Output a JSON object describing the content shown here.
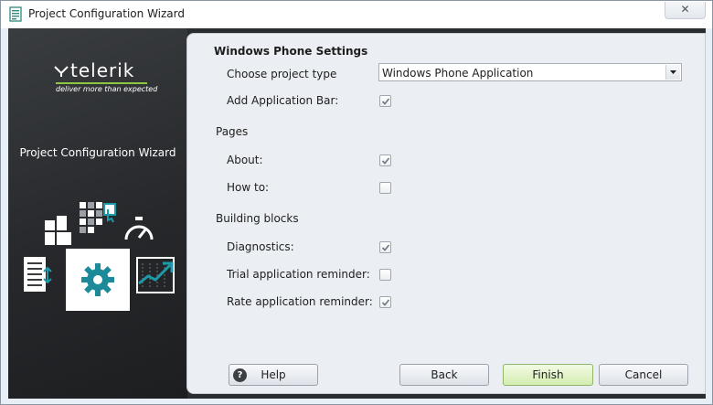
{
  "window": {
    "title": "Project Configuration Wizard",
    "close_glyph": "✕"
  },
  "brand": {
    "logo_text": "telerik",
    "tagline": "deliver more than expected",
    "wizard_title": "Project Configuration Wizard",
    "accent_color": "#8dc63f",
    "app_icon": "document-list-icon",
    "tile_icons": [
      "tiles-icon",
      "grid-touch-icon",
      "speedometer-icon",
      "list-touch-icon",
      "gear-icon",
      "chart-trend-icon"
    ]
  },
  "form": {
    "section_title": "Windows Phone Settings",
    "project_type": {
      "label": "Choose project type",
      "value": "Windows Phone Application"
    },
    "app_bar": {
      "label": "Add Application Bar:",
      "checked": true
    },
    "pages_group": "Pages",
    "pages": [
      {
        "label": "About:",
        "checked": true
      },
      {
        "label": "How to:",
        "checked": false
      }
    ],
    "blocks_group": "Building blocks",
    "blocks": [
      {
        "label": "Diagnostics:",
        "checked": true
      },
      {
        "label": "Trial application reminder:",
        "checked": false
      },
      {
        "label": "Rate application reminder:",
        "checked": true
      }
    ]
  },
  "buttons": {
    "help": "Help",
    "help_glyph": "?",
    "back": "Back",
    "finish": "Finish",
    "cancel": "Cancel"
  }
}
